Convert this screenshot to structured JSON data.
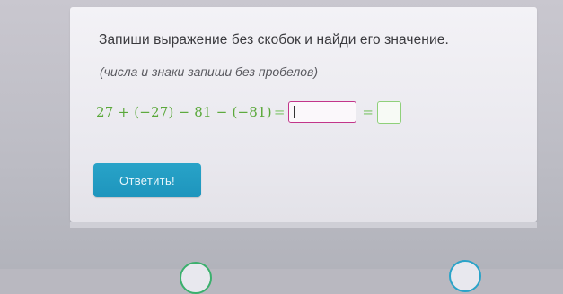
{
  "task": {
    "instruction": "Запиши выражение без скобок и найди его значение.",
    "hint": "(числа и знаки запиши без пробелов)",
    "expression": "27 + (−27) − 81 − (−81)",
    "equals_sign": "=",
    "answer_expression_value": "",
    "answer_result_value": ""
  },
  "actions": {
    "submit_label": "Ответить!"
  },
  "colors": {
    "expression_green": "#5aa83a",
    "active_input_border": "#c2358a",
    "result_input_border": "#8fd07a",
    "submit_button": "#1e95bd"
  }
}
